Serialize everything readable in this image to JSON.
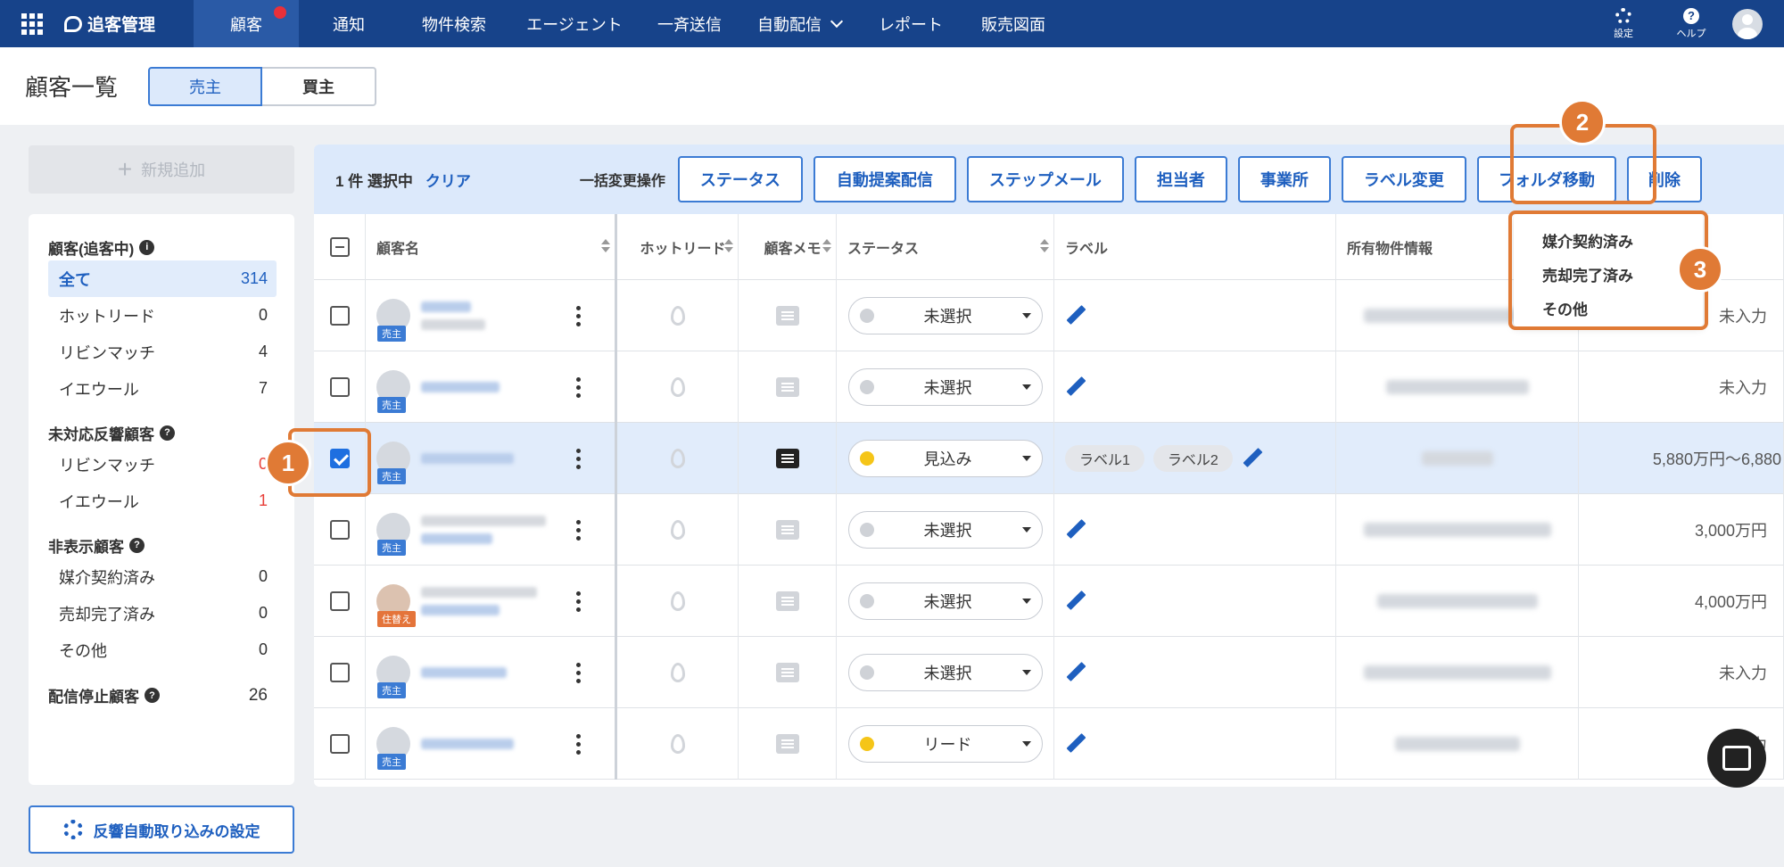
{
  "topnav": {
    "brand": "追客管理",
    "items": [
      "顧客",
      "通知",
      "物件検索",
      "エージェント",
      "一斉送信",
      "自動配信",
      "レポート",
      "販売図面"
    ],
    "settings": "設定",
    "help": "ヘルプ"
  },
  "page": {
    "title": "顧客一覧",
    "seller": "売主",
    "buyer": "買主"
  },
  "sidebar": {
    "new_button": "新規追加",
    "group1_title": "顧客(追客中)",
    "group1": [
      {
        "label": "全て",
        "count": "314"
      },
      {
        "label": "ホットリード",
        "count": "0"
      },
      {
        "label": "リビンマッチ",
        "count": "4"
      },
      {
        "label": "イエウール",
        "count": "7"
      }
    ],
    "group2_title": "未対応反響顧客",
    "group2": [
      {
        "label": "リビンマッチ",
        "count": "0"
      },
      {
        "label": "イエウール",
        "count": "1"
      }
    ],
    "group3_title": "非表示顧客",
    "group3": [
      {
        "label": "媒介契約済み",
        "count": "0"
      },
      {
        "label": "売却完了済み",
        "count": "0"
      },
      {
        "label": "その他",
        "count": "0"
      }
    ],
    "stopped_label": "配信停止顧客",
    "stopped_count": "26",
    "import_button": "反響自動取り込みの設定"
  },
  "bulk": {
    "selected": "1 件 選択中",
    "clear": "クリア",
    "label": "一括変更操作",
    "buttons": [
      "ステータス",
      "自動提案配信",
      "ステップメール",
      "担当者",
      "事業所",
      "ラベル変更",
      "フォルダ移動",
      "削除"
    ]
  },
  "table": {
    "headers": {
      "name": "顧客名",
      "hot": "ホットリード",
      "memo": "顧客メモ",
      "status": "ステータス",
      "label": "ラベル",
      "property": "所有物件情報"
    },
    "rows": [
      {
        "tag": "売主",
        "status": "未選択",
        "price": "未入力"
      },
      {
        "tag": "売主",
        "status": "未選択",
        "price": "未入力"
      },
      {
        "tag": "売主",
        "status": "見込み",
        "price": "5,880万円～6,880",
        "label1": "ラベル1",
        "label2": "ラベル2"
      },
      {
        "tag": "売主",
        "status": "未選択",
        "price": "3,000万円"
      },
      {
        "tag": "住替え",
        "status": "未選択",
        "price": "4,000万円"
      },
      {
        "tag": "売主",
        "status": "未選択",
        "price": "未入力"
      },
      {
        "tag": "売主",
        "status": "リード",
        "price": "未入力"
      }
    ]
  },
  "dropdown": [
    "媒介契約済み",
    "売却完了済み",
    "その他"
  ],
  "annotations": [
    "1",
    "2",
    "3"
  ],
  "colors": {
    "nav": "#17438a",
    "accent": "#1e5fbf",
    "annotation": "#e07a35"
  }
}
